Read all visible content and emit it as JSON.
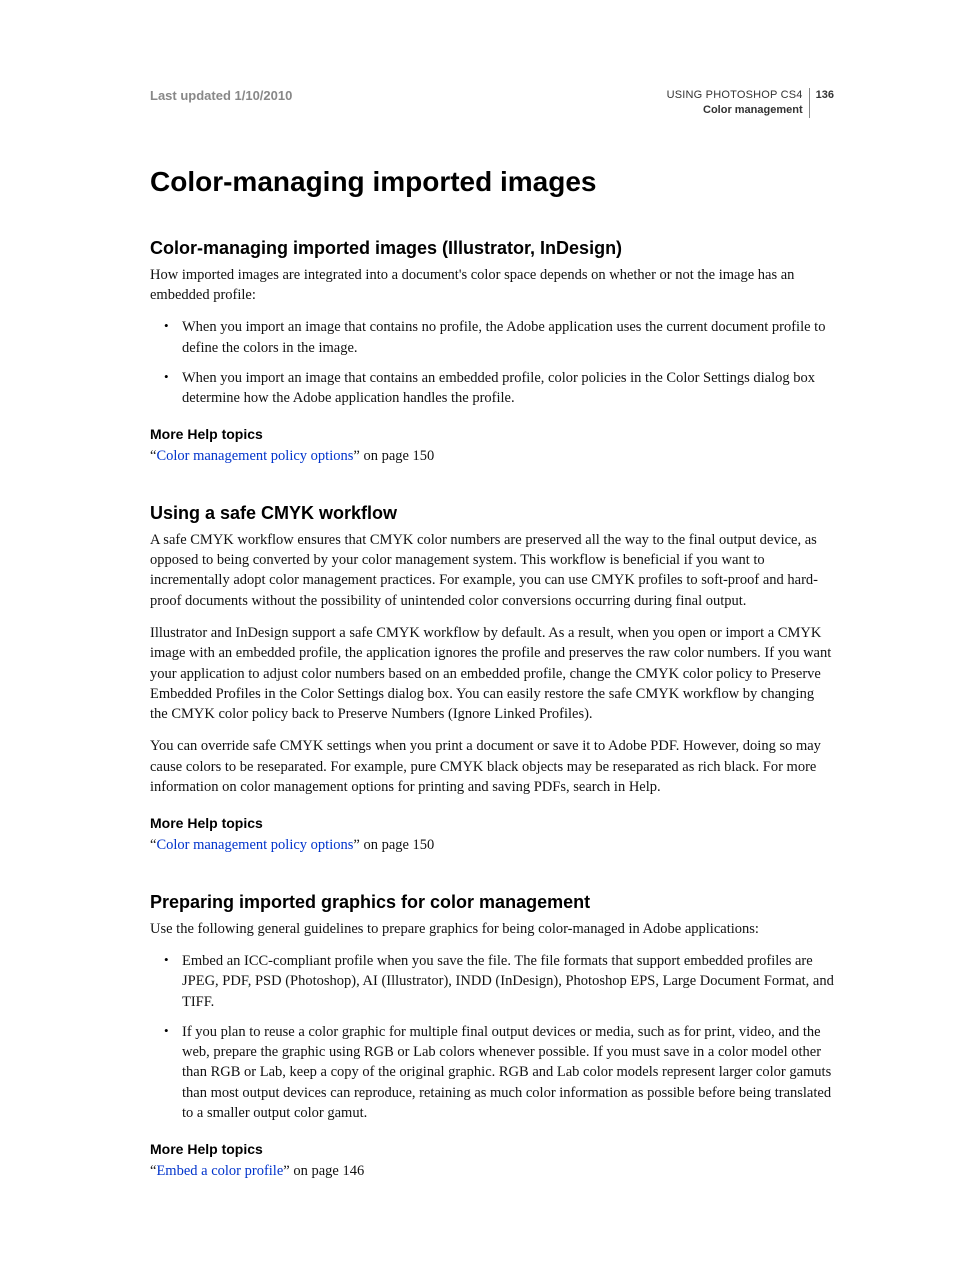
{
  "header": {
    "last_updated": "Last updated 1/10/2010",
    "product": "USING PHOTOSHOP CS4",
    "chapter": "Color management",
    "page_number": "136"
  },
  "title": "Color-managing imported images",
  "sections": [
    {
      "heading": "Color-managing imported images (Illustrator, InDesign)",
      "paragraphs_before": [
        "How imported images are integrated into a document's color space depends on whether or not the image has an embedded profile:"
      ],
      "bullets": [
        "When you import an image that contains no profile, the Adobe application uses the current document profile to define the colors in the image.",
        "When you import an image that contains an embedded profile, color policies in the Color Settings dialog box determine how the Adobe application handles the profile."
      ],
      "more_help_label": "More Help topics",
      "help_link_text": "Color management policy options",
      "help_suffix": " on page 150"
    },
    {
      "heading": "Using a safe CMYK workflow",
      "paragraphs_before": [
        "A safe CMYK workflow ensures that CMYK color numbers are preserved all the way to the final output device, as opposed to being converted by your color management system. This workflow is beneficial if you want to incrementally adopt color management practices. For example, you can use CMYK profiles to soft-proof and hard-proof documents without the possibility of unintended color conversions occurring during final output.",
        "Illustrator and InDesign support a safe CMYK workflow by default. As a result, when you open or import a CMYK image with an embedded profile, the application ignores the profile and preserves the raw color numbers. If you want your application to adjust color numbers based on an embedded profile, change the CMYK color policy to Preserve Embedded Profiles in the Color Settings dialog box. You can easily restore the safe CMYK workflow by changing the CMYK color policy back to Preserve Numbers (Ignore Linked Profiles).",
        "You can override safe CMYK settings when you print a document or save it to Adobe PDF. However, doing so may cause colors to be reseparated. For example, pure CMYK black objects may be reseparated as rich black. For more information on color management options for printing and saving PDFs, search in Help."
      ],
      "more_help_label": "More Help topics",
      "help_link_text": "Color management policy options",
      "help_suffix": " on page 150"
    },
    {
      "heading": "Preparing imported graphics for color management",
      "paragraphs_before": [
        "Use the following general guidelines to prepare graphics for being color-managed in Adobe applications:"
      ],
      "bullets": [
        "Embed an ICC-compliant profile when you save the file. The file formats that support embedded profiles are JPEG, PDF, PSD (Photoshop), AI (Illustrator), INDD (InDesign), Photoshop EPS, Large Document Format, and TIFF.",
        "If you plan to reuse a color graphic for multiple final output devices or media, such as for print, video, and the web, prepare the graphic using RGB or Lab colors whenever possible. If you must save in a color model other than RGB or Lab, keep a copy of the original graphic. RGB and Lab color models represent larger color gamuts than most output devices can reproduce, retaining as much color information as possible before being translated to a smaller output color gamut."
      ],
      "more_help_label": "More Help topics",
      "help_link_text": "Embed a color profile",
      "help_suffix": " on page 146"
    }
  ]
}
